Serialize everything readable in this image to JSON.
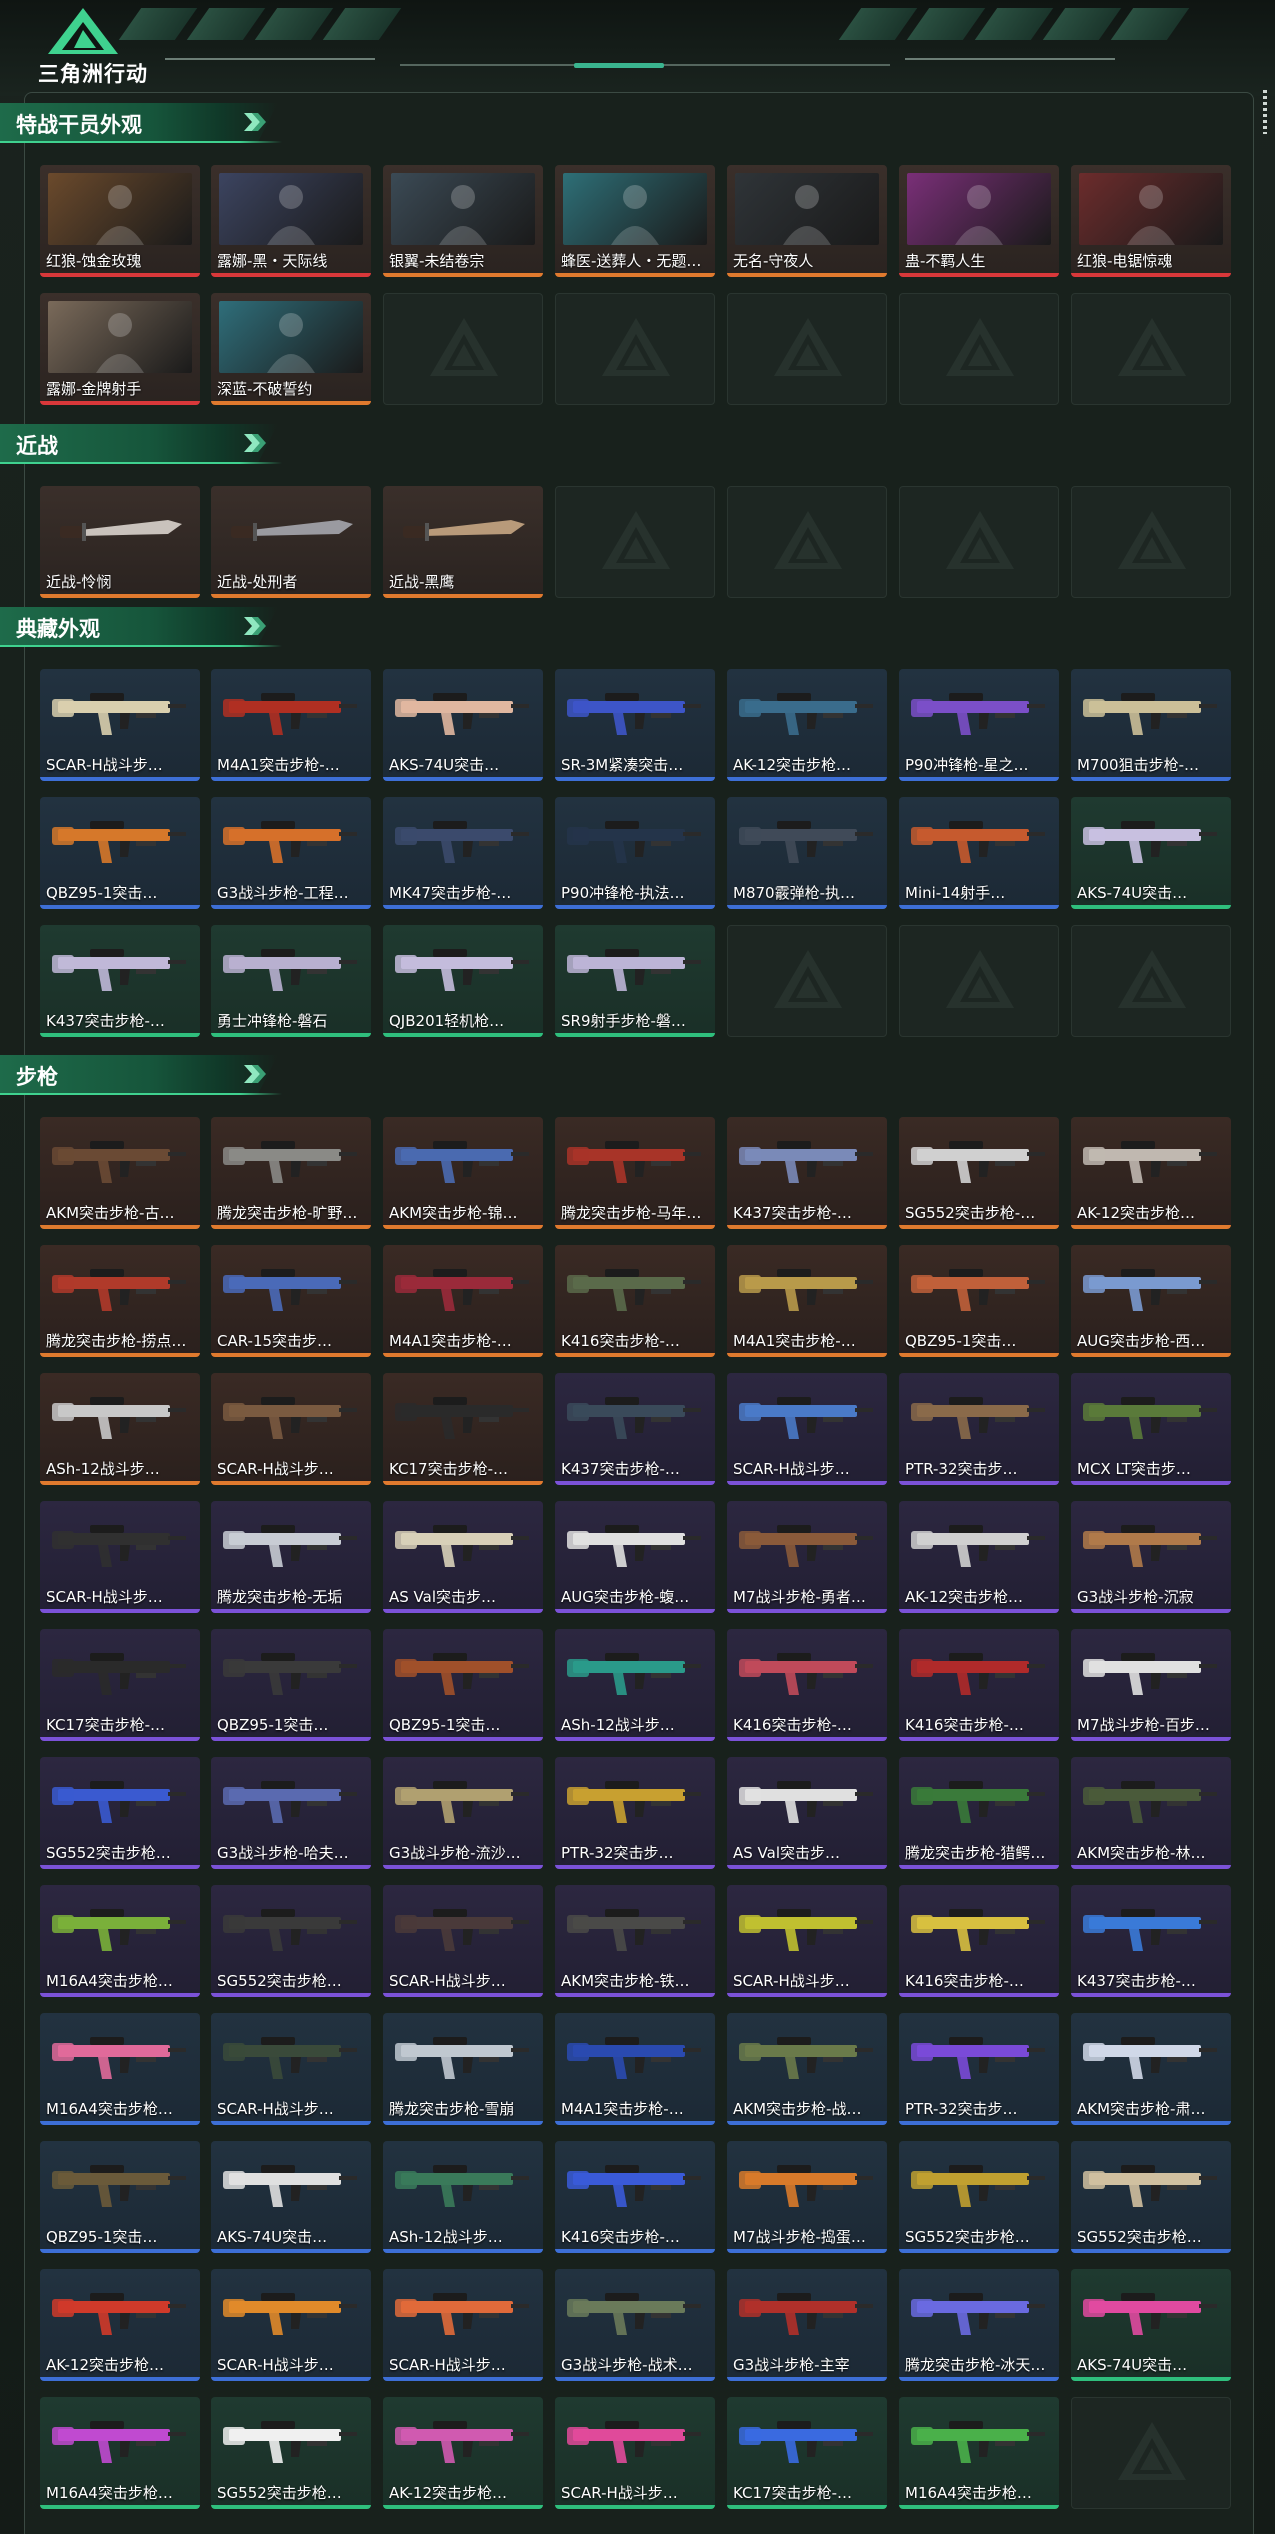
{
  "header": {
    "brand": "三角洲行动"
  },
  "colors": {
    "blue": "#3d6fd6",
    "green": "#2fbf7d",
    "orange": "#e07a2e",
    "purple": "#7b52d8",
    "red": "#d9383a",
    "accent": "#3fd28f"
  },
  "sections": [
    {
      "title": "特战干员外观",
      "empty": 5,
      "items": [
        {
          "name": "红狼-蚀金玫瑰",
          "rarity": "red",
          "art": "#6b4a2c"
        },
        {
          "name": "露娜-黑・天际线",
          "rarity": "red",
          "art": "#3c4460"
        },
        {
          "name": "银翼-未结卷宗",
          "rarity": "orange",
          "art": "#3b4a55"
        },
        {
          "name": "蜂医-送葬人・无题…",
          "rarity": "orange",
          "art": "#2e6f77"
        },
        {
          "name": "无名-守夜人",
          "rarity": "orange",
          "art": "#2f3438"
        },
        {
          "name": "蛊-不羁人生",
          "rarity": "red",
          "art": "#7a2f78"
        },
        {
          "name": "红狼-电锯惊魂",
          "rarity": "red",
          "art": "#6c2c2c"
        },
        {
          "name": "露娜-金牌射手",
          "rarity": "red",
          "art": "#7a6a5a"
        },
        {
          "name": "深蓝-不破誓约",
          "rarity": "orange",
          "art": "#2f6e7a"
        }
      ]
    },
    {
      "title": "近战",
      "empty": 4,
      "items": [
        {
          "name": "近战-怜悯",
          "rarity": "orange",
          "art": "#c9c2bc"
        },
        {
          "name": "近战-处刑者",
          "rarity": "orange",
          "art": "#9a9aa0"
        },
        {
          "name": "近战-黑鹰",
          "rarity": "orange",
          "art": "#b89a7a"
        }
      ]
    },
    {
      "title": "典藏外观",
      "empty": 3,
      "items": [
        {
          "name": "SCAR-H战斗步…",
          "rarity": "blue",
          "art": "#d9cfae"
        },
        {
          "name": "M4A1突击步枪-…",
          "rarity": "blue",
          "art": "#b02f22"
        },
        {
          "name": "AKS-74U突击…",
          "rarity": "blue",
          "art": "#e0b7a0"
        },
        {
          "name": "SR-3M紧凑突击…",
          "rarity": "blue",
          "art": "#3d55c8"
        },
        {
          "name": "AK-12突击步枪…",
          "rarity": "blue",
          "art": "#3a6c8c"
        },
        {
          "name": "P90冲锋枪-星之…",
          "rarity": "blue",
          "art": "#7b4fc8"
        },
        {
          "name": "M700狙击步枪-…",
          "rarity": "blue",
          "art": "#cbbf98"
        },
        {
          "name": "QBZ95-1突击…",
          "rarity": "blue",
          "art": "#d6782a"
        },
        {
          "name": "G3战斗步枪-工程…",
          "rarity": "blue",
          "art": "#d6702a"
        },
        {
          "name": "MK47突击步枪-…",
          "rarity": "blue",
          "art": "#3b4a6c"
        },
        {
          "name": "P90冲锋枪-执法…",
          "rarity": "blue",
          "art": "#24344a"
        },
        {
          "name": "M870霰弹枪-执…",
          "rarity": "blue",
          "art": "#404a58"
        },
        {
          "name": "Mini-14射手…",
          "rarity": "blue",
          "art": "#c65a2e"
        },
        {
          "name": "AKS-74U突击…",
          "rarity": "green",
          "art": "#c8c0e0"
        },
        {
          "name": "K437突击步枪-…",
          "rarity": "green",
          "art": "#c0b8d8"
        },
        {
          "name": "勇士冲锋枪-磐石",
          "rarity": "green",
          "art": "#b8b0d0"
        },
        {
          "name": "QJB201轻机枪…",
          "rarity": "green",
          "art": "#c4bcdc"
        },
        {
          "name": "SR9射手步枪-磐…",
          "rarity": "green",
          "art": "#bcb4d6"
        }
      ]
    },
    {
      "title": "步枪",
      "empty": 1,
      "items": [
        {
          "name": "AKM突击步枪-古…",
          "rarity": "orange",
          "art": "#6a4a34"
        },
        {
          "name": "腾龙突击步枪-旷野…",
          "rarity": "orange",
          "art": "#8a8a86"
        },
        {
          "name": "AKM突击步枪-锦…",
          "rarity": "orange",
          "art": "#4a6ab0"
        },
        {
          "name": "腾龙突击步枪-马年…",
          "rarity": "orange",
          "art": "#a83428"
        },
        {
          "name": "K437突击步枪-…",
          "rarity": "orange",
          "art": "#7a8ab8"
        },
        {
          "name": "SG552突击步枪-…",
          "rarity": "orange",
          "art": "#d0d0d0"
        },
        {
          "name": "AK-12突击步枪…",
          "rarity": "orange",
          "art": "#c0b8b0"
        },
        {
          "name": "腾龙突击步枪-捞点…",
          "rarity": "orange",
          "art": "#b03a2a"
        },
        {
          "name": "CAR-15突击步…",
          "rarity": "orange",
          "art": "#4a6ab8"
        },
        {
          "name": "M4A1突击步枪-…",
          "rarity": "orange",
          "art": "#9a2a3a"
        },
        {
          "name": "K416突击步枪-…",
          "rarity": "orange",
          "art": "#5a6a4a"
        },
        {
          "name": "M4A1突击步枪-…",
          "rarity": "orange",
          "art": "#b89a4a"
        },
        {
          "name": "QBZ95-1突击…",
          "rarity": "orange",
          "art": "#c0603a"
        },
        {
          "name": "AUG突击步枪-西…",
          "rarity": "orange",
          "art": "#7a9ad0"
        },
        {
          "name": "ASh-12战斗步…",
          "rarity": "orange",
          "art": "#c8c8c8"
        },
        {
          "name": "SCAR-H战斗步…",
          "rarity": "orange",
          "art": "#7a5a40"
        },
        {
          "name": "KC17突击步枪-…",
          "rarity": "orange",
          "art": "#2a2a2a"
        },
        {
          "name": "K437突击步枪-…",
          "rarity": "purple",
          "art": "#3a4a5a"
        },
        {
          "name": "SCAR-H战斗步…",
          "rarity": "purple",
          "art": "#4a7ac8"
        },
        {
          "name": "PTR-32突击步…",
          "rarity": "purple",
          "art": "#8a6a4a"
        },
        {
          "name": "MCX LT突击步…",
          "rarity": "purple",
          "art": "#5a7a3a"
        },
        {
          "name": "SCAR-H战斗步…",
          "rarity": "purple",
          "art": "#303030"
        },
        {
          "name": "腾龙突击步枪-无垢",
          "rarity": "purple",
          "art": "#c8ccd4"
        },
        {
          "name": "AS Val突击步…",
          "rarity": "purple",
          "art": "#d8d0b8"
        },
        {
          "name": "AUG突击步枪-蝮…",
          "rarity": "purple",
          "art": "#e0e0e0"
        },
        {
          "name": "M7战斗步枪-勇者…",
          "rarity": "purple",
          "art": "#8a5a3a"
        },
        {
          "name": "AK-12突击步枪…",
          "rarity": "purple",
          "art": "#d0d0d0"
        },
        {
          "name": "G3战斗步枪-沉寂",
          "rarity": "purple",
          "art": "#b07a4a"
        },
        {
          "name": "KC17突击步枪-…",
          "rarity": "purple",
          "art": "#2a2a2a"
        },
        {
          "name": "QBZ95-1突击…",
          "rarity": "purple",
          "art": "#3a3a3a"
        },
        {
          "name": "QBZ95-1突击…",
          "rarity": "purple",
          "art": "#a0502a"
        },
        {
          "name": "ASh-12战斗步…",
          "rarity": "purple",
          "art": "#2a9a8a"
        },
        {
          "name": "K416突击步枪-…",
          "rarity": "purple",
          "art": "#c04a5a"
        },
        {
          "name": "K416突击步枪-…",
          "rarity": "purple",
          "art": "#b02a2a"
        },
        {
          "name": "M7战斗步枪-百步…",
          "rarity": "purple",
          "art": "#e0e0e0"
        },
        {
          "name": "SG552突击步枪…",
          "rarity": "purple",
          "art": "#3a5ad0"
        },
        {
          "name": "G3战斗步枪-哈夫…",
          "rarity": "purple",
          "art": "#5a6ab0"
        },
        {
          "name": "G3战斗步枪-流沙…",
          "rarity": "purple",
          "art": "#b0a070"
        },
        {
          "name": "PTR-32突击步…",
          "rarity": "purple",
          "art": "#c8a030"
        },
        {
          "name": "AS Val突击步…",
          "rarity": "purple",
          "art": "#e0e0e0"
        },
        {
          "name": "腾龙突击步枪-猎鳄…",
          "rarity": "purple",
          "art": "#3a7a3a"
        },
        {
          "name": "AKM突击步枪-林…",
          "rarity": "purple",
          "art": "#4a5a3a"
        },
        {
          "name": "M16A4突击步枪…",
          "rarity": "purple",
          "art": "#7ab03a"
        },
        {
          "name": "SG552突击步枪…",
          "rarity": "purple",
          "art": "#3a3a3a"
        },
        {
          "name": "SCAR-H战斗步…",
          "rarity": "purple",
          "art": "#4a3a3a"
        },
        {
          "name": "AKM突击步枪-铁…",
          "rarity": "purple",
          "art": "#4a4a48"
        },
        {
          "name": "SCAR-H战斗步…",
          "rarity": "purple",
          "art": "#c0c030"
        },
        {
          "name": "K416突击步枪-…",
          "rarity": "purple",
          "art": "#d8c040"
        },
        {
          "name": "K437突击步枪-…",
          "rarity": "purple",
          "art": "#3a7ad8"
        },
        {
          "name": "M16A4突击步枪…",
          "rarity": "blue",
          "art": "#e06a9a"
        },
        {
          "name": "SCAR-H战斗步…",
          "rarity": "blue",
          "art": "#3a4a3a"
        },
        {
          "name": "腾龙突击步枪-雪崩",
          "rarity": "blue",
          "art": "#c0c8d0"
        },
        {
          "name": "M4A1突击步枪-…",
          "rarity": "blue",
          "art": "#2a4ab0"
        },
        {
          "name": "AKM突击步枪-战…",
          "rarity": "blue",
          "art": "#6a7a4a"
        },
        {
          "name": "PTR-32突击步…",
          "rarity": "blue",
          "art": "#7a4ad8"
        },
        {
          "name": "AKM突击步枪-肃…",
          "rarity": "blue",
          "art": "#d0d8e8"
        },
        {
          "name": "QBZ95-1突击…",
          "rarity": "blue",
          "art": "#6a5a3a"
        },
        {
          "name": "AKS-74U突击…",
          "rarity": "blue",
          "art": "#e0e0e0"
        },
        {
          "name": "ASh-12战斗步…",
          "rarity": "blue",
          "art": "#3a7a5a"
        },
        {
          "name": "K416突击步枪-…",
          "rarity": "blue",
          "art": "#3a5ad8"
        },
        {
          "name": "M7战斗步枪-捣蛋…",
          "rarity": "blue",
          "art": "#d87a2a"
        },
        {
          "name": "SG552突击步枪…",
          "rarity": "blue",
          "art": "#c0a030"
        },
        {
          "name": "SG552突击步枪…",
          "rarity": "blue",
          "art": "#d0c0a0"
        },
        {
          "name": "AK-12突击步枪…",
          "rarity": "blue",
          "art": "#d03a2a"
        },
        {
          "name": "SCAR-H战斗步…",
          "rarity": "blue",
          "art": "#e08a2a"
        },
        {
          "name": "SCAR-H战斗步…",
          "rarity": "blue",
          "art": "#e06a3a"
        },
        {
          "name": "G3战斗步枪-战术…",
          "rarity": "blue",
          "art": "#6a7a5a"
        },
        {
          "name": "G3战斗步枪-主宰",
          "rarity": "blue",
          "art": "#b0302a"
        },
        {
          "name": "腾龙突击步枪-冰天…",
          "rarity": "blue",
          "art": "#6a6ae0"
        },
        {
          "name": "AKS-74U突击…",
          "rarity": "green",
          "art": "#e04aa0"
        },
        {
          "name": "M16A4突击步枪…",
          "rarity": "green",
          "art": "#c04ad0"
        },
        {
          "name": "SG552突击步枪…",
          "rarity": "green",
          "art": "#f0f0f0"
        },
        {
          "name": "AK-12突击步枪…",
          "rarity": "green",
          "art": "#d05ab0"
        },
        {
          "name": "SCAR-H战斗步…",
          "rarity": "green",
          "art": "#e04a9a"
        },
        {
          "name": "KC17突击步枪-…",
          "rarity": "green",
          "art": "#3a6ae0"
        },
        {
          "name": "M16A4突击步枪…",
          "rarity": "green",
          "art": "#4ab04a"
        }
      ]
    }
  ]
}
